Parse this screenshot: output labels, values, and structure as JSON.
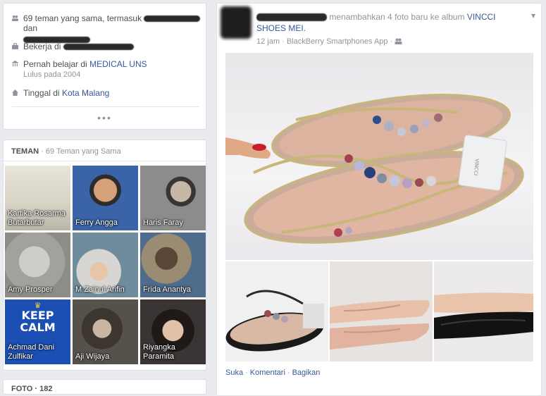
{
  "intro": {
    "mutual_friends_prefix": "69 teman yang sama, termasuk",
    "mutual_friends_and": "dan",
    "work_prefix": "Bekerja di",
    "education_prefix": "Pernah belajar di",
    "education_school": "MEDICAL UNS",
    "education_sub": "Lulus pada 2004",
    "lives_prefix": "Tinggal di",
    "lives_city": "Kota Malang",
    "more": "•••"
  },
  "friends": {
    "title": "TEMAN",
    "mutual": "· 69 Teman yang Sama",
    "items": [
      {
        "name": "Kartika Rosarma Butarbutar"
      },
      {
        "name": "Ferry Angga"
      },
      {
        "name": "Haris Faray"
      },
      {
        "name": "Amy Prosper"
      },
      {
        "name": "M Zainul Arifin"
      },
      {
        "name": "Frida Anantya"
      },
      {
        "name": "Achmad Dani Zulfikar"
      },
      {
        "name": "Aji Wijaya"
      },
      {
        "name": "Riyangka Paramita"
      }
    ]
  },
  "photos_card": {
    "title": "FOTO · 182"
  },
  "post": {
    "action": "menambahkan 4 foto baru ke album",
    "album": "VINCCI SHOES MEI.",
    "time": "12 jam",
    "source": "BlackBerry Smartphones App",
    "actions": {
      "like": "Suka",
      "comment": "Komentari",
      "share": "Bagikan"
    },
    "tag_text": "VINCCI"
  },
  "icons": {
    "friends": "friends-icon",
    "work": "briefcase-icon",
    "education": "school-icon",
    "home": "home-icon",
    "audience": "friends-audience-icon",
    "chevron": "chevron-down-icon"
  }
}
